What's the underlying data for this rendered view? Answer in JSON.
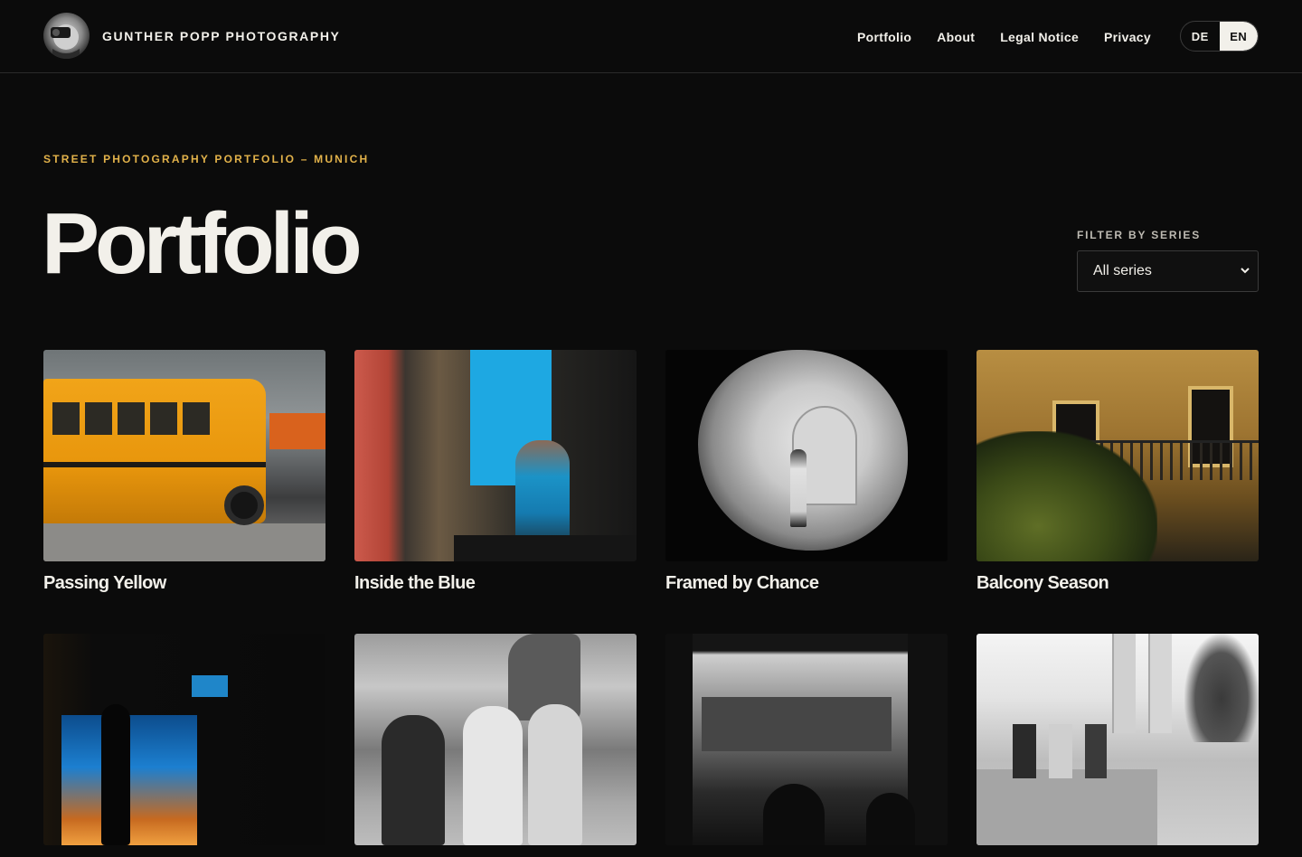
{
  "header": {
    "brand_name": "GUNTHER POPP PHOTOGRAPHY",
    "nav": [
      {
        "label": "Portfolio"
      },
      {
        "label": "About"
      },
      {
        "label": "Legal Notice"
      },
      {
        "label": "Privacy"
      }
    ],
    "lang": {
      "de": "DE",
      "en": "EN",
      "active": "EN"
    }
  },
  "hero": {
    "eyebrow": "STREET PHOTOGRAPHY PORTFOLIO – MUNICH",
    "title": "Portfolio"
  },
  "filter": {
    "label": "FILTER BY SERIES",
    "selected": "All series"
  },
  "grid": {
    "items": [
      {
        "title": "Passing Yellow"
      },
      {
        "title": "Inside the Blue"
      },
      {
        "title": "Framed by Chance"
      },
      {
        "title": "Balcony Season"
      },
      {
        "title": ""
      },
      {
        "title": ""
      },
      {
        "title": ""
      },
      {
        "title": ""
      }
    ]
  },
  "colors": {
    "background": "#0b0b0b",
    "text": "#f2f0ea",
    "accent": "#e2b24a"
  }
}
